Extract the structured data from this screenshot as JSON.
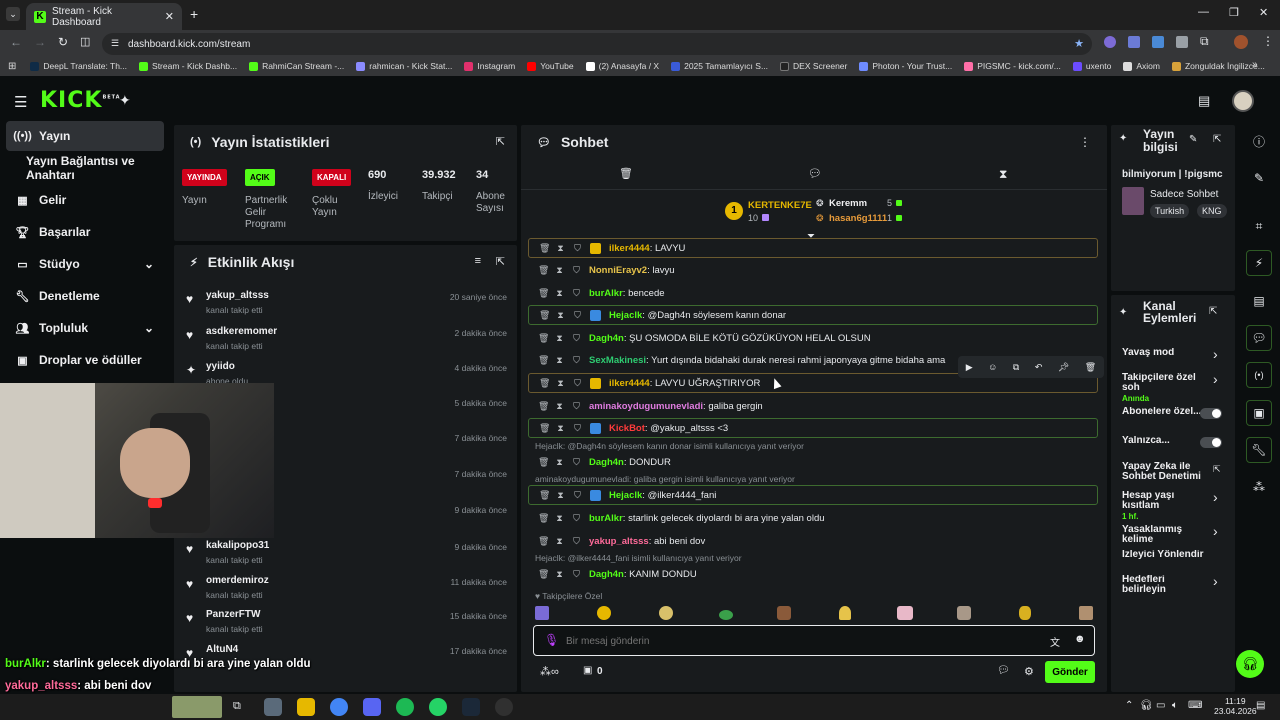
{
  "browser": {
    "tab_title": "Stream - Kick Dashboard",
    "url": "dashboard.kick.com/stream"
  },
  "bookmarks": [
    {
      "label": "DeepL Translate: Th...",
      "color": "#0f2b46"
    },
    {
      "label": "Stream - Kick Dashb...",
      "color": "#53fc18"
    },
    {
      "label": "RahmiCan Stream -...",
      "color": "#53fc18"
    },
    {
      "label": "rahmican - Kick Stat...",
      "color": "#8b8bff"
    },
    {
      "label": "Instagram",
      "color": "#e1306c"
    },
    {
      "label": "YouTube",
      "color": "#ff0000"
    },
    {
      "label": "(2) Anasayfa / X",
      "color": "#ffffff"
    },
    {
      "label": "2025 Tamamlayıcı S...",
      "color": "#3a5bd9"
    },
    {
      "label": "DEX Screener",
      "color": "#222222"
    },
    {
      "label": "Photon - Your Trust...",
      "color": "#6e8bff"
    },
    {
      "label": "PIGSMC - kick.com/...",
      "color": "#ff6fa8"
    },
    {
      "label": "uxento",
      "color": "#6b4cff"
    },
    {
      "label": "Axiom",
      "color": "#dddddd"
    },
    {
      "label": "Zonguldak İngilizce...",
      "color": "#d8a23a"
    }
  ],
  "kick": {
    "logo": "KICK",
    "beta": "BETA"
  },
  "sidebar": {
    "items": [
      {
        "label": "Yayın",
        "icon": "broadcast-icon",
        "active": true
      },
      {
        "label": "Yayın Bağlantısı ve Anahtarı",
        "icon": "",
        "active": false
      },
      {
        "label": "Gelir",
        "icon": "revenue-icon",
        "active": false
      },
      {
        "label": "Başarılar",
        "icon": "trophy-icon",
        "active": false
      },
      {
        "label": "Stüdyo",
        "icon": "studio-icon",
        "active": false
      },
      {
        "label": "Denetleme",
        "icon": "wrench-icon",
        "active": false
      },
      {
        "label": "Topluluk",
        "icon": "community-icon",
        "active": false
      },
      {
        "label": "Droplar ve ödüller",
        "icon": "drops-icon",
        "active": false
      }
    ]
  },
  "stats": {
    "title": "Yayın İstatistikleri",
    "badges": [
      {
        "text": "YAYINDA",
        "label": "Yayın",
        "color": "#d0021b"
      },
      {
        "text": "AÇIK",
        "label": "Partnerlik Gelir Programı",
        "color": "#53fc18"
      },
      {
        "text": "KAPALI",
        "label": "Çoklu Yayın",
        "color": "#d0021b"
      }
    ],
    "numbers": [
      {
        "value": "690",
        "label": "İzleyici"
      },
      {
        "value": "39.932",
        "label": "Takipçi"
      },
      {
        "value": "34",
        "label": "Abone Sayısı"
      }
    ]
  },
  "activity": {
    "title": "Etkinlik Akışı",
    "events": [
      {
        "name": "yakup_altsss",
        "desc": "kanalı takip etti",
        "time": "20 saniye önce"
      },
      {
        "name": "asdkeremomer",
        "desc": "kanalı takip etti",
        "time": "2 dakika önce"
      },
      {
        "name": "yyiido",
        "desc": "abone oldu",
        "time": "4 dakika önce"
      },
      {
        "name": "",
        "desc": "",
        "time": "5 dakika önce"
      },
      {
        "name": "",
        "desc": "",
        "time": "7 dakika önce"
      },
      {
        "name": "",
        "desc": "",
        "time": "7 dakika önce"
      },
      {
        "name": "",
        "desc": "",
        "time": "9 dakika önce"
      },
      {
        "name": "kakalipopo31",
        "desc": "kanalı takip etti",
        "time": "9 dakika önce"
      },
      {
        "name": "omerdemiroz",
        "desc": "kanalı takip etti",
        "time": "11 dakika önce"
      },
      {
        "name": "PanzerFTW",
        "desc": "kanalı takip etti",
        "time": "15 dakika önce"
      },
      {
        "name": "AltuN4",
        "desc": "",
        "time": "17 dakika önce"
      }
    ]
  },
  "chat": {
    "title": "Sohbet",
    "top_gifters": {
      "first": {
        "rank": "1",
        "name": "KERTENKE7E",
        "count": "10"
      },
      "second": {
        "name": "Keremm",
        "count": "5"
      },
      "third": {
        "name": "hasan6g1111",
        "count": "1"
      }
    },
    "messages": [
      {
        "user": "ilker4444",
        "text": "LAVYU",
        "color": "#e6b800",
        "hl": "y"
      },
      {
        "user": "NonniErayv2",
        "text": "lavyu",
        "color": "#e6c34a",
        "hl": ""
      },
      {
        "user": "burAlkr",
        "text": "bencede",
        "color": "#53fc18",
        "hl": ""
      },
      {
        "user": "Hejaclk",
        "text": "@Dagh4n söylesem kanın donar",
        "color": "#53fc18",
        "hl": "g"
      },
      {
        "user": "Dagh4n",
        "text": "ŞU OSMODA BİLE KÖTÜ GÖZÜKÜYON HELAL OLSUN",
        "color": "#53fc18",
        "hl": ""
      },
      {
        "user": "SexMakinesi",
        "text": "Yurt dışında bidahaki durak neresi rahmi japonyaya gitme bidaha ama",
        "color": "#2ecc71",
        "hl": ""
      },
      {
        "user": "ilker4444",
        "text": "LAVYU UĞRAŞTIRIYOR",
        "color": "#e6b800",
        "hl": "y"
      },
      {
        "user": "aminakoydugumunevladi",
        "text": "galiba gergin",
        "color": "#e07ce0",
        "hl": ""
      },
      {
        "user": "KickBot",
        "text": "@yakup_altsss <3",
        "color": "#ff3b3b",
        "hl": "g"
      },
      {
        "user": "Dagh4n",
        "text": "DONDUR",
        "color": "#53fc18",
        "hl": "",
        "reply": "Hejaclk: @Dagh4n söylesem kanın donar isimli kullanıcıya yanıt veriyor"
      },
      {
        "user": "Hejaclk",
        "text": "@ilker4444_fani",
        "color": "#53fc18",
        "hl": "g",
        "reply": "aminakoydugumunevladi: galiba gergin isimli kullanıcıya yanıt veriyor"
      },
      {
        "user": "burAlkr",
        "text": "starlink gelecek diyolardı bi ara yine yalan oldu",
        "color": "#53fc18",
        "hl": ""
      },
      {
        "user": "yakup_altsss",
        "text": "abi beni dov",
        "color": "#ff6b9a",
        "hl": ""
      },
      {
        "user": "Dagh4n",
        "text": "KANIM DONDU",
        "color": "#53fc18",
        "hl": "",
        "reply": "Hejaclk: @ilker4444_fani isimli kullanıcıya yanıt veriyor"
      }
    ],
    "followers_only": "Takipçilere Özel",
    "input_placeholder": "Bir mesaj gönderin",
    "send_label": "Gönder",
    "footer_count": "0"
  },
  "stream_info": {
    "title": "Yayın bilgisi",
    "stream_title": "bilmiyorum | !pigsmc",
    "category": "Sadece Sohbet",
    "tags": [
      "Turkish",
      "KNG"
    ]
  },
  "channel_actions": {
    "title": "Kanal Eylemleri",
    "items": [
      {
        "label": "Yavaş mod",
        "sub": "",
        "type": "arrow"
      },
      {
        "label": "Takipçilere özel soh",
        "sub": "Anında",
        "type": "arrow"
      },
      {
        "label": "Abonelere özel...",
        "sub": "",
        "type": "toggle"
      },
      {
        "label": "Yalnızca...",
        "sub": "",
        "type": "toggle"
      },
      {
        "label": "Yapay Zeka ile Sohbet Denetimi",
        "sub": "",
        "type": "link"
      },
      {
        "label": "Hesap yaşı kısıtlam",
        "sub": "1 hf.",
        "type": "arrow"
      },
      {
        "label": "Yasaklanmış kelime",
        "sub": "",
        "type": "arrow"
      },
      {
        "label": "İzleyici Yönlendir",
        "sub": "",
        "type": ""
      },
      {
        "label": "Hedefleri belirleyin",
        "sub": "",
        "type": "arrow"
      }
    ]
  },
  "overlay_chat": [
    {
      "user": "burAlkr",
      "text": ": starlink gelecek diyolardı bi ara yine yalan oldu",
      "color": "#53fc18"
    },
    {
      "user": "yakup_altsss",
      "text": ": abi beni dov",
      "color": "#ff6b9a"
    },
    {
      "user": "Dagh4n",
      "text": ": KANIM DONDU",
      "color": "#53fc18"
    }
  ],
  "taskbar": {
    "time": "11:19",
    "date": "23.04.2026"
  }
}
